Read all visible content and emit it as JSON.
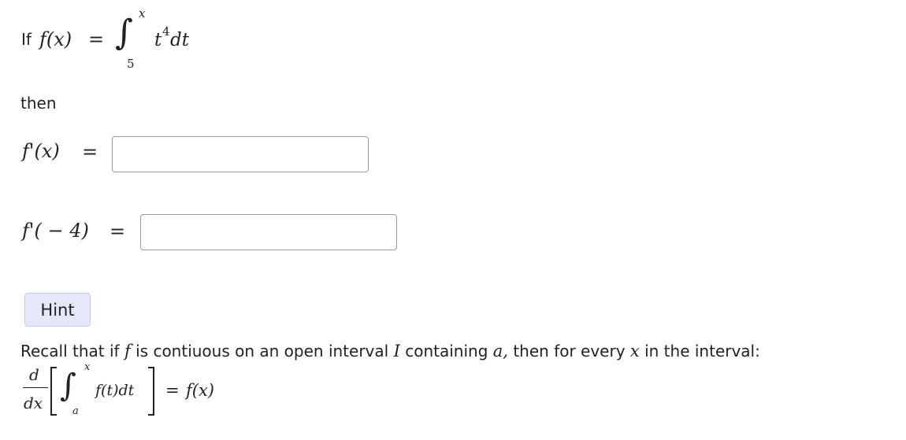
{
  "question": {
    "if_text": "If",
    "f_lhs": "f(x)",
    "eq": "=",
    "upper_limit": "x",
    "lower_limit": "5",
    "integrand_base": "t",
    "integrand_exp": "4",
    "integrand_d": "dt",
    "then_text": "then"
  },
  "answers": [
    {
      "lhs": "f'(x)",
      "eq": "=",
      "value": "",
      "placeholder": ""
    },
    {
      "lhs": "f'( − 4)",
      "eq": "=",
      "value": "",
      "placeholder": ""
    }
  ],
  "hint": {
    "button_label": "Hint",
    "text_part1": "Recall that if",
    "f": "f",
    "text_part2": "is contiuous on an open interval",
    "I": "I",
    "text_part3": "containing",
    "a": "a,",
    "text_part4": "then for every",
    "x": "x",
    "text_part5": "in the interval:",
    "frac_num": "d",
    "frac_den": "dx",
    "upper_limit": "x",
    "lower_limit": "a",
    "integrand": "f(t)dt",
    "eq": "=",
    "rhs": "f(x)"
  }
}
